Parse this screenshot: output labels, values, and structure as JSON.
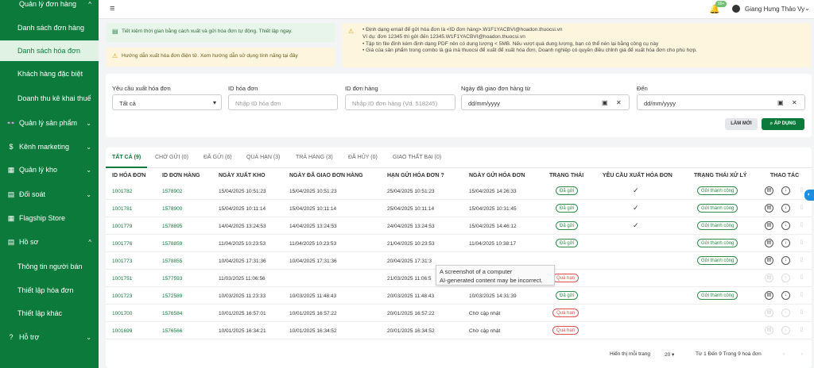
{
  "sidebar": {
    "items": [
      {
        "icon": "",
        "label": "Quản lý đơn hàng",
        "chevron": "^",
        "active": false,
        "sub": false
      },
      {
        "icon": "",
        "label": "Danh sách đơn hàng",
        "chevron": "",
        "active": false,
        "sub": true
      },
      {
        "icon": "",
        "label": "Danh sách hóa đơn",
        "chevron": "",
        "active": true,
        "sub": true
      },
      {
        "icon": "",
        "label": "Khách hàng đặc biệt",
        "chevron": "",
        "active": false,
        "sub": true
      },
      {
        "icon": "",
        "label": "Doanh thu kê khai thuế",
        "chevron": "",
        "active": false,
        "sub": true
      },
      {
        "icon": "👓",
        "label": "Quản lý sản phẩm",
        "chevron": "⌄",
        "active": false,
        "sub": false
      },
      {
        "icon": "$",
        "label": "Kênh marketing",
        "chevron": "⌄",
        "active": false,
        "sub": false
      },
      {
        "icon": "▦",
        "label": "Quản lý kho",
        "chevron": "⌄",
        "active": false,
        "sub": false
      },
      {
        "icon": "▤",
        "label": "Đối soát",
        "chevron": "⌄",
        "active": false,
        "sub": false
      },
      {
        "icon": "▦",
        "label": "Flagship Store",
        "chevron": "",
        "active": false,
        "sub": false
      },
      {
        "icon": "▤",
        "label": "Hồ sơ",
        "chevron": "^",
        "active": false,
        "sub": false
      },
      {
        "icon": "",
        "label": "Thông tin người bán",
        "chevron": "",
        "active": false,
        "sub": true
      },
      {
        "icon": "",
        "label": "Thiết lập hóa đơn",
        "chevron": "",
        "active": false,
        "sub": true
      },
      {
        "icon": "",
        "label": "Thiết lập khác",
        "chevron": "",
        "active": false,
        "sub": true
      },
      {
        "icon": "?",
        "label": "Hỗ trợ",
        "chevron": "⌄",
        "active": false,
        "sub": false
      }
    ]
  },
  "topbar": {
    "menu_icon": "≡",
    "bell_badge": "99+",
    "user_name": "Giang Hưng Thảo Vy"
  },
  "notices": {
    "n1": "Tiết kiệm thời gian bằng cách xuất và gửi hóa đơn tự động. Thiết lập ngay.",
    "n2": "Hướng dẫn xuất hóa đơn điện tử. Xem hướng dẫn sử dụng tính năng tại đây",
    "n3_lines": [
      "•  Định dạng email để gửi hóa đơn là <ID đơn hàng>.W1F1YACBVI@hoadon.thuocsi.vn",
      "    Ví dụ: đơn 12345 thì gửi đến 12345.W1F1YACBVI@hoadon.thuocsi.vn",
      "•  Tập tin file đính kèm định dạng PDF nên có dung lượng < 5MB. Nếu vượt quá dung lượng, bạn có thể nén lại bằng công cụ này",
      "•  Giá của sản phẩm trong combo là giá mà thuocsi để xuất để xuất hóa đơn. Doanh nghiệp có quyền điều chỉnh giá để xuất hóa đơn cho phù hợp."
    ]
  },
  "filters": {
    "req_label": "Yêu cầu xuất hóa đơn",
    "req_value": "Tất cả",
    "invoice_label": "ID hóa đơn",
    "invoice_placeholder": "Nhập ID hóa đơn",
    "order_label": "ID đơn hàng",
    "order_placeholder": "Nhập ID đơn hàng (Vd. 518245)",
    "from_label": "Ngày đã giao đơn hàng từ",
    "from_placeholder": "dd/mm/yyyy",
    "to_label": "Đến",
    "to_placeholder": "dd/mm/yyyy",
    "reset_label": "LÀM MỚI",
    "apply_label": "ÁP DỤNG"
  },
  "tabs": [
    "TẤT CẢ (9)",
    "CHỜ GỬI (0)",
    "ĐÃ GỬI (6)",
    "QUÁ HẠN (3)",
    "TRẢ HÀNG (3)",
    "ĐÃ HỦY (0)",
    "GIAO THẤT BẠI (0)"
  ],
  "columns": [
    "ID HÓA ĐƠN",
    "ID ĐƠN HÀNG",
    "NGÀY XUẤT KHO",
    "NGÀY ĐÃ GIAO ĐƠN HÀNG",
    "HẠN GỬI HÓA ĐƠN",
    "NGÀY GỬI HÓA ĐƠN",
    "TRẠNG THÁI",
    "YÊU CẦU XUẤT HÓA ĐƠN",
    "TRẠNG THÁI XỬ LÝ",
    "THAO TÁC"
  ],
  "rows": [
    {
      "invoice": "1001782",
      "order": "1578902",
      "export": "15/04/2025 10:51:23",
      "delivered": "15/04/2025 10:51:23",
      "deadline": "25/04/2025 10:51:23",
      "sent": "15/04/2025 14:26:33",
      "status": "Đã gửi",
      "status_type": "ok",
      "request": "✓",
      "processing": "Gửi thành công",
      "actions_enabled": true
    },
    {
      "invoice": "1001781",
      "order": "1578900",
      "export": "15/04/2025 10:11:14",
      "delivered": "15/04/2025 10:11:14",
      "deadline": "25/04/2025 10:11:14",
      "sent": "15/04/2025 10:31:45",
      "status": "Đã gửi",
      "status_type": "ok",
      "request": "✓",
      "processing": "Gửi thành công",
      "actions_enabled": true
    },
    {
      "invoice": "1001779",
      "order": "1578895",
      "export": "14/04/2025 13:24:53",
      "delivered": "14/04/2025 13:24:53",
      "deadline": "24/04/2025 13:24:53",
      "sent": "15/04/2025 14:46:12",
      "status": "Đã gửi",
      "status_type": "ok",
      "request": "✓",
      "processing": "Gửi thành công",
      "actions_enabled": true
    },
    {
      "invoice": "1001776",
      "order": "1578859",
      "export": "11/04/2025 10:23:53",
      "delivered": "11/04/2025 10:23:53",
      "deadline": "21/04/2025 10:23:53",
      "sent": "11/04/2025 10:38:17",
      "status": "Đã gửi",
      "status_type": "ok",
      "request": "",
      "processing": "Gửi thành công",
      "actions_enabled": true
    },
    {
      "invoice": "1001773",
      "order": "1578855",
      "export": "10/04/2025 17:31:36",
      "delivered": "10/04/2025 17:31:36",
      "deadline": "20/04/2025 17:31:3",
      "sent": "",
      "status": "",
      "status_type": "ok",
      "request": "",
      "processing": "Gửi thành công",
      "actions_enabled": true
    },
    {
      "invoice": "1001751",
      "order": "1577593",
      "export": "11/03/2025 11:06:56",
      "delivered": "",
      "deadline": "21/03/2025 11:06:5",
      "sent": "",
      "status": "Quá hạn",
      "status_type": "bad",
      "request": "",
      "processing": "",
      "actions_enabled": false
    },
    {
      "invoice": "1001723",
      "order": "1572589",
      "export": "10/03/2025 11:23:33",
      "delivered": "10/03/2025 11:48:43",
      "deadline": "20/03/2025 11:48:43",
      "sent": "10/03/2025 14:31:39",
      "status": "Đã gửi",
      "status_type": "ok",
      "request": "",
      "processing": "Gửi thành công",
      "actions_enabled": true
    },
    {
      "invoice": "1001700",
      "order": "1576584",
      "export": "10/01/2025 16:57:01",
      "delivered": "10/01/2025 16:57:22",
      "deadline": "20/01/2025 16:57:22",
      "sent": "Chờ cập nhật",
      "status": "Quá hạn",
      "status_type": "bad",
      "request": "",
      "processing": "",
      "actions_enabled": false
    },
    {
      "invoice": "1001699",
      "order": "1576566",
      "export": "10/01/2025 16:34:21",
      "delivered": "10/01/2025 16:34:52",
      "deadline": "20/01/2025 16:34:52",
      "sent": "Chờ cập nhật",
      "status": "Quá hạn",
      "status_type": "bad",
      "request": "",
      "processing": "",
      "actions_enabled": false
    }
  ],
  "pager": {
    "per_page_label": "Hiển thị mỗi trang",
    "per_page": "20",
    "range": "Từ 1 Đến 9 Trong 9 hoá đơn"
  },
  "tooltip": {
    "line1": "A screenshot of a computer",
    "line2": "AI-generated content may be incorrect."
  },
  "colors": {
    "brand": "#0b7a3b",
    "success": "#2e8b4a",
    "danger": "#e05050"
  }
}
